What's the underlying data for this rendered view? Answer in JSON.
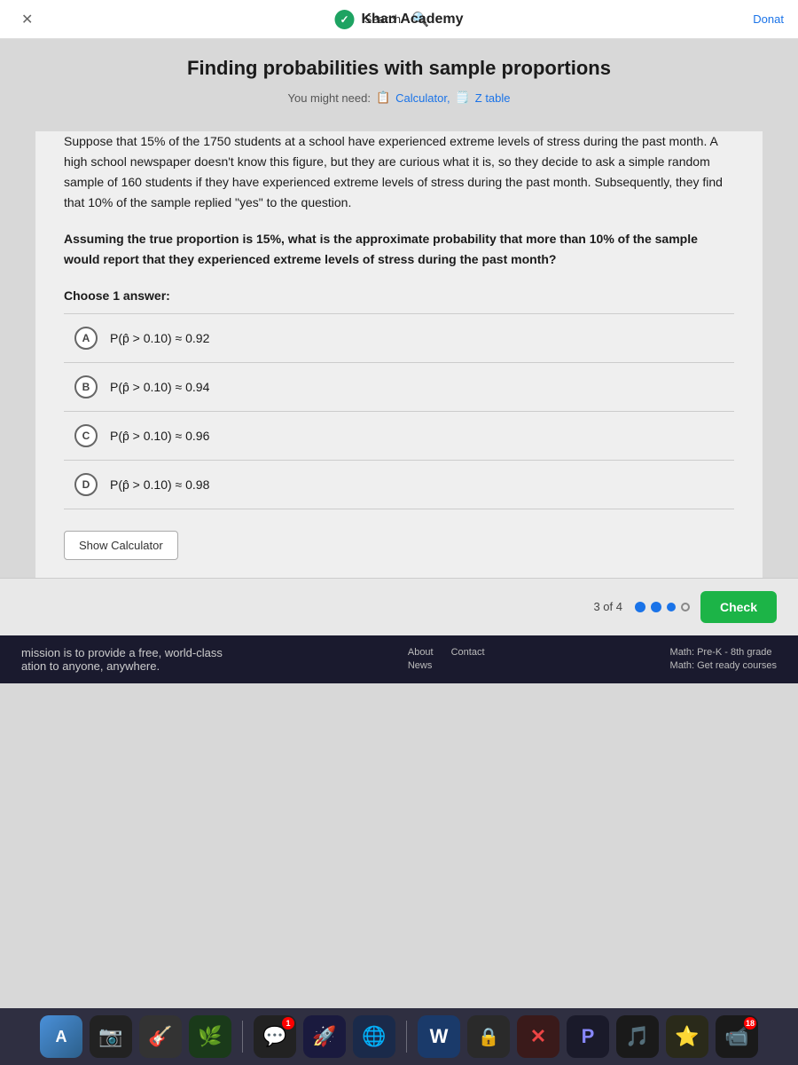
{
  "topbar": {
    "search_label": "Search",
    "site_name": "Khan Academy",
    "donate_label": "Donat"
  },
  "page": {
    "title": "Finding probabilities with sample proportions",
    "you_might_need_label": "You might need:",
    "calculator_label": "Calculator,",
    "ztable_label": "Z table"
  },
  "problem": {
    "text1": "Suppose that 15% of the 1750 students at a school have experienced extreme levels of stress during the past month. A high school newspaper doesn't know this figure, but they are curious what it is, so they decide to ask a simple random sample of 160 students if they have experienced extreme levels of stress during the past month. Subsequently, they find that 10% of the sample replied \"yes\" to the question.",
    "question": "Assuming the true proportion is 15%, what is the approximate probability that more than 10% of the sample would report that they experienced extreme levels of stress during the past month?",
    "choose_label": "Choose 1 answer:"
  },
  "choices": [
    {
      "id": "A",
      "text": "P(p̂ > 0.10) ≈ 0.92"
    },
    {
      "id": "B",
      "text": "P(p̂ > 0.10) ≈ 0.94"
    },
    {
      "id": "C",
      "text": "P(p̂ > 0.10) ≈ 0.96"
    },
    {
      "id": "D",
      "text": "P(p̂ > 0.10) ≈ 0.98"
    }
  ],
  "buttons": {
    "show_calculator": "Show Calculator",
    "check": "Check"
  },
  "progress": {
    "label": "3 of 4"
  },
  "footer": {
    "mission_text": "mission is to provide a free, world-class",
    "mission_text2": "ation to anyone, anywhere.",
    "about_label": "About",
    "news_label": "News",
    "contact_label": "Contact",
    "math_prek_label": "Math: Pre-K - 8th grade",
    "math_ready_label": "Math: Get ready courses"
  },
  "dock": {
    "items": [
      {
        "icon": "🅐",
        "label": "finder",
        "badge": null
      },
      {
        "icon": "📷",
        "label": "photos",
        "badge": null
      },
      {
        "icon": "🎸",
        "label": "music",
        "badge": null
      },
      {
        "icon": "🌿",
        "label": "nature",
        "badge": null
      },
      {
        "icon": "💬",
        "label": "messages",
        "badge": "1"
      },
      {
        "icon": "🚀",
        "label": "launch",
        "badge": null
      },
      {
        "icon": "🌐",
        "label": "browser",
        "badge": null
      },
      {
        "icon": "W",
        "label": "word",
        "badge": null
      },
      {
        "icon": "🔒",
        "label": "security",
        "badge": null
      },
      {
        "icon": "✖",
        "label": "close",
        "badge": null
      },
      {
        "icon": "P",
        "label": "app-p",
        "badge": null
      },
      {
        "icon": "🎵",
        "label": "itunes",
        "badge": null
      },
      {
        "icon": "⭐",
        "label": "favorites",
        "badge": null
      },
      {
        "icon": "📹",
        "label": "video",
        "badge": "18"
      }
    ]
  }
}
